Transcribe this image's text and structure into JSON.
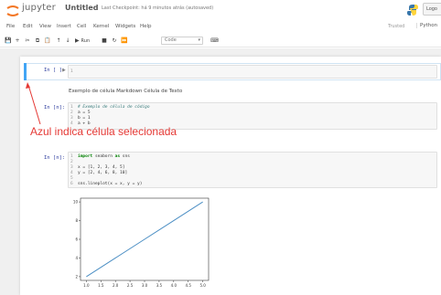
{
  "header": {
    "brand": "jupyter",
    "notebook_title": "Untitled",
    "checkpoint": "Last Checkpoint: há 9 minutos atrás  (autosaved)",
    "logout": "Logo"
  },
  "menubar": {
    "items": [
      "File",
      "Edit",
      "View",
      "Insert",
      "Cell",
      "Kernel",
      "Widgets",
      "Help"
    ],
    "trusted": "Trusted",
    "kernel": "Python"
  },
  "toolbar": {
    "run_label": "Run",
    "cell_type": "Code"
  },
  "cells": [
    {
      "prompt": "In [ ]:",
      "code": [
        "1"
      ]
    },
    {
      "markdown": "Exemplo de célula Markdown Célula de Texto"
    },
    {
      "prompt": "In [n]:",
      "code": [
        "# Exemplo de célula de código",
        "a = 5",
        "b = 1",
        "a + b"
      ]
    },
    {
      "prompt": "In [n]:",
      "code": [
        "import seaborn as sns",
        "",
        "x = [1, 2, 3, 4, 5]",
        "y = [2, 4, 6, 8, 10]",
        "",
        "sns.lineplot(x = x, y = y)"
      ]
    }
  ],
  "annotation": "Azul indica célula selecionada",
  "colors": {
    "selected": "#42a5f5",
    "annotation": "#e53935",
    "line": "#4c8fc4"
  },
  "chart_data": {
    "type": "line",
    "x": [
      1,
      2,
      3,
      4,
      5
    ],
    "series": [
      {
        "values": [
          2,
          4,
          6,
          8,
          10
        ]
      }
    ],
    "xlim": [
      0.8,
      5.2
    ],
    "ylim": [
      1.6,
      10.4
    ],
    "xticks": [
      "1.0",
      "1.5",
      "2.0",
      "2.5",
      "3.0",
      "3.5",
      "4.0",
      "4.5",
      "5.0"
    ],
    "yticks": [
      "2",
      "4",
      "6",
      "8",
      "10"
    ],
    "grid": false
  }
}
